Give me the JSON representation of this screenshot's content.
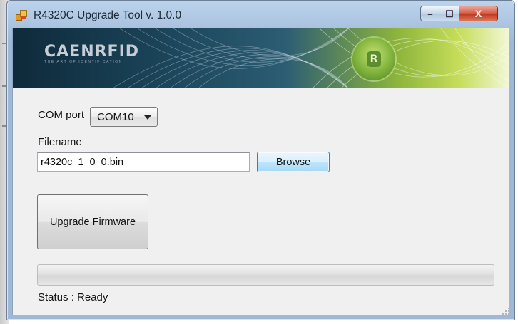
{
  "window": {
    "title": "R4320C Upgrade Tool v. 1.0.0",
    "controls": {
      "minimize": "–",
      "maximize": "☐",
      "close": "X"
    }
  },
  "banner": {
    "brand": "CAENRFID",
    "tagline": "THE ART OF IDENTIFICATION",
    "logo_letter": "R",
    "colors": {
      "dark": "#0e2a3b",
      "green": "#8fb63c"
    }
  },
  "form": {
    "com_port_label": "COM port",
    "com_port_value": "COM10",
    "filename_label": "Filename",
    "filename_value": "r4320c_1_0_0.bin",
    "browse_label": "Browse",
    "upgrade_label": "Upgrade Firmware"
  },
  "progress": {
    "value": 0,
    "fill_color": "#37c837"
  },
  "status": {
    "text": "Status : Ready"
  }
}
